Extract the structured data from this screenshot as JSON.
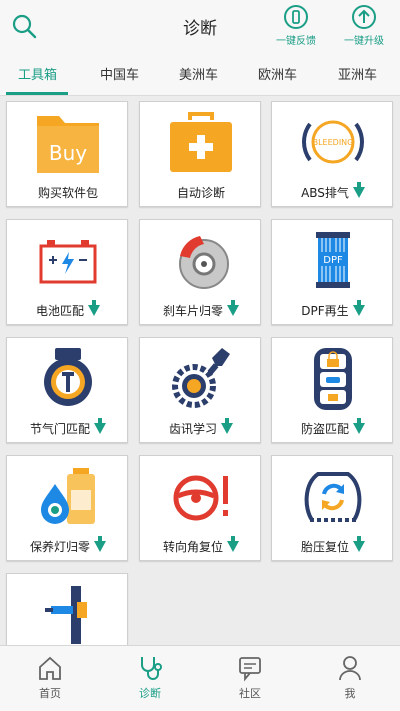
{
  "header": {
    "title": "诊断",
    "feedback_label": "一键反馈",
    "upgrade_label": "一键升级"
  },
  "tabs": [
    {
      "label": "工具箱",
      "active": true
    },
    {
      "label": "中国车"
    },
    {
      "label": "美洲车"
    },
    {
      "label": "欧洲车"
    },
    {
      "label": "亚洲车"
    }
  ],
  "tiles": [
    {
      "label": "购买软件包",
      "icon": "buy-folder-icon",
      "buy_text": "Buy",
      "download": false
    },
    {
      "label": "自动诊断",
      "icon": "medical-kit-icon",
      "download": false
    },
    {
      "label": "ABS排气",
      "icon": "abs-bleeding-icon",
      "badge_text": "BLEEDING",
      "download": true
    },
    {
      "label": "电池匹配",
      "icon": "battery-icon",
      "download": true
    },
    {
      "label": "刹车片归零",
      "icon": "brake-disc-icon",
      "download": true
    },
    {
      "label": "DPF再生",
      "icon": "dpf-filter-icon",
      "badge_text": "DPF",
      "download": true
    },
    {
      "label": "节气门匹配",
      "icon": "throttle-icon",
      "download": true
    },
    {
      "label": "齿讯学习",
      "icon": "gear-sensor-icon",
      "download": true
    },
    {
      "label": "防盗匹配",
      "icon": "anti-theft-key-icon",
      "download": true
    },
    {
      "label": "保养灯归零",
      "icon": "oil-maintenance-icon",
      "download": true
    },
    {
      "label": "转向角复位",
      "icon": "steering-wheel-icon",
      "download": true
    },
    {
      "label": "胎压复位",
      "icon": "tire-pressure-icon",
      "download": true
    },
    {
      "label": "",
      "icon": "injector-icon",
      "download": false
    }
  ],
  "bottom_nav": [
    {
      "label": "首页",
      "icon": "home-icon"
    },
    {
      "label": "诊断",
      "icon": "stethoscope-icon",
      "active": true
    },
    {
      "label": "社区",
      "icon": "chat-bubble-icon"
    },
    {
      "label": "我",
      "icon": "person-icon"
    }
  ],
  "colors": {
    "accent": "#1a9e86",
    "orange": "#f5a623",
    "red": "#e03b2e",
    "navy": "#2c3e6b"
  }
}
